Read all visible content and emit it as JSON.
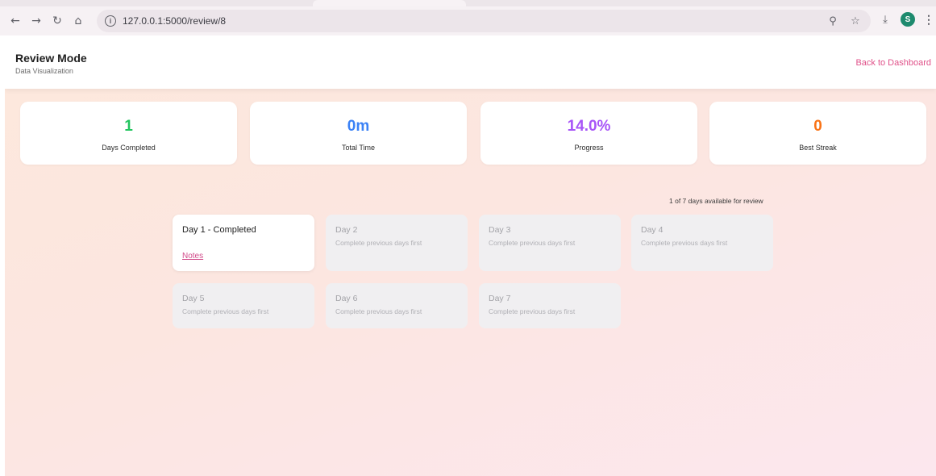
{
  "browser": {
    "url": "127.0.0.1:5000/review/8",
    "avatar_letter": "S",
    "icons": [
      "back-arrow-icon",
      "forward-arrow-icon",
      "reload-icon",
      "home-icon",
      "info-icon",
      "zoom-icon",
      "star-icon",
      "download-icon",
      "menu-icon"
    ]
  },
  "header": {
    "title": "Review Mode",
    "subtitle": "Data Visualization",
    "back_link": "Back to Dashboard"
  },
  "stats": [
    {
      "value": "1",
      "label": "Days Completed",
      "color": "#22c55e"
    },
    {
      "value": "0m",
      "label": "Total Time",
      "color": "#3b82f6"
    },
    {
      "value": "14.0%",
      "label": "Progress",
      "color": "#a855f7"
    },
    {
      "value": "0",
      "label": "Best Streak",
      "color": "#f97316"
    }
  ],
  "availability_text": "1 of 7 days available for review",
  "days": [
    {
      "title": "Day 1 - Completed",
      "status": "completed",
      "link": "Notes"
    },
    {
      "title": "Day 2",
      "status": "locked",
      "message": "Complete previous days first"
    },
    {
      "title": "Day 3",
      "status": "locked",
      "message": "Complete previous days first"
    },
    {
      "title": "Day 4",
      "status": "locked",
      "message": "Complete previous days first"
    },
    {
      "title": "Day 5",
      "status": "locked",
      "message": "Complete previous days first"
    },
    {
      "title": "Day 6",
      "status": "locked",
      "message": "Complete previous days first"
    },
    {
      "title": "Day 7",
      "status": "locked",
      "message": "Complete previous days first"
    }
  ],
  "colors": {
    "accent": "#e0528a"
  }
}
